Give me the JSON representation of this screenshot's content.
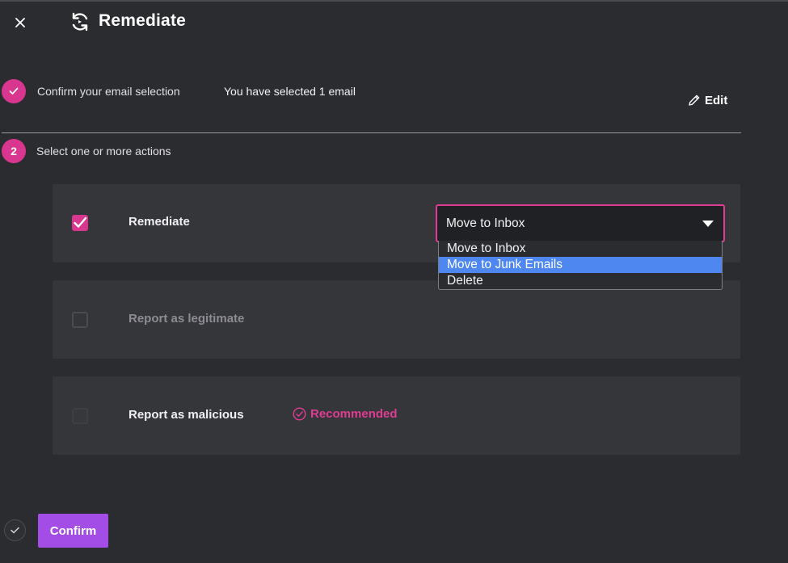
{
  "header": {
    "title": "Remediate",
    "close_icon": "close-icon",
    "title_icon": "remediate-refresh-icon"
  },
  "steps": {
    "step1": {
      "label": "Confirm your email selection",
      "status": "completed",
      "summary": "You have selected 1 email",
      "edit_label": "Edit"
    },
    "step2": {
      "number": "2",
      "label": "Select one or more actions"
    }
  },
  "actions": [
    {
      "label": "Remediate",
      "checked": true,
      "select": {
        "value": "Move to Inbox",
        "options": [
          "Move to Inbox",
          "Move to Junk Emails",
          "Delete"
        ],
        "highlighted": "Move to Junk Emails"
      }
    },
    {
      "label": "Report as legitimate",
      "checked": false,
      "disabled": true
    },
    {
      "label": "Report as malicious",
      "checked": false,
      "badge": "Recommended"
    }
  ],
  "footer": {
    "confirm_label": "Confirm"
  },
  "colors": {
    "background": "#2b2c30",
    "card": "#35363a",
    "accent_pink": "#d8368f",
    "confirm_purple": "#a34de6",
    "highlight_blue": "#4e87f0"
  }
}
